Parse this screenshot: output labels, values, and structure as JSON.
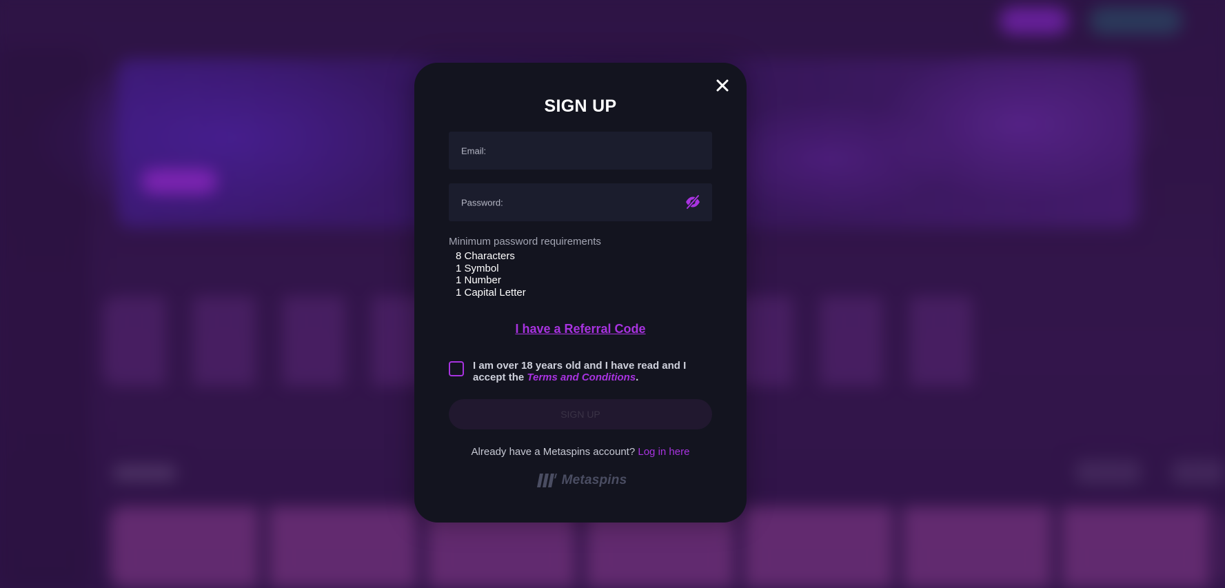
{
  "modal": {
    "title": "SIGN UP",
    "email_label": "Email:",
    "password_label": "Password:",
    "requirements_title": "Minimum password requirements",
    "requirements": [
      "8 Characters",
      "1 Symbol",
      "1 Number",
      "1 Capital Letter"
    ],
    "referral_link": "I have a Referral Code",
    "terms_prefix": "I am over 18 years old and I have read and I accept the ",
    "terms_link": "Terms and Conditions",
    "terms_suffix": ".",
    "submit_label": "SIGN UP",
    "login_prompt": "Already have a Metaspins account?",
    "login_link": "Log in here",
    "logo_text": "Metaspins"
  },
  "colors": {
    "accent": "#a833e0",
    "modal_bg": "#13141f",
    "field_bg": "#1b1d2d"
  },
  "icons": {
    "close": "close-icon",
    "eye": "eye-slash-icon",
    "logo": "metaspins-logo-icon"
  }
}
